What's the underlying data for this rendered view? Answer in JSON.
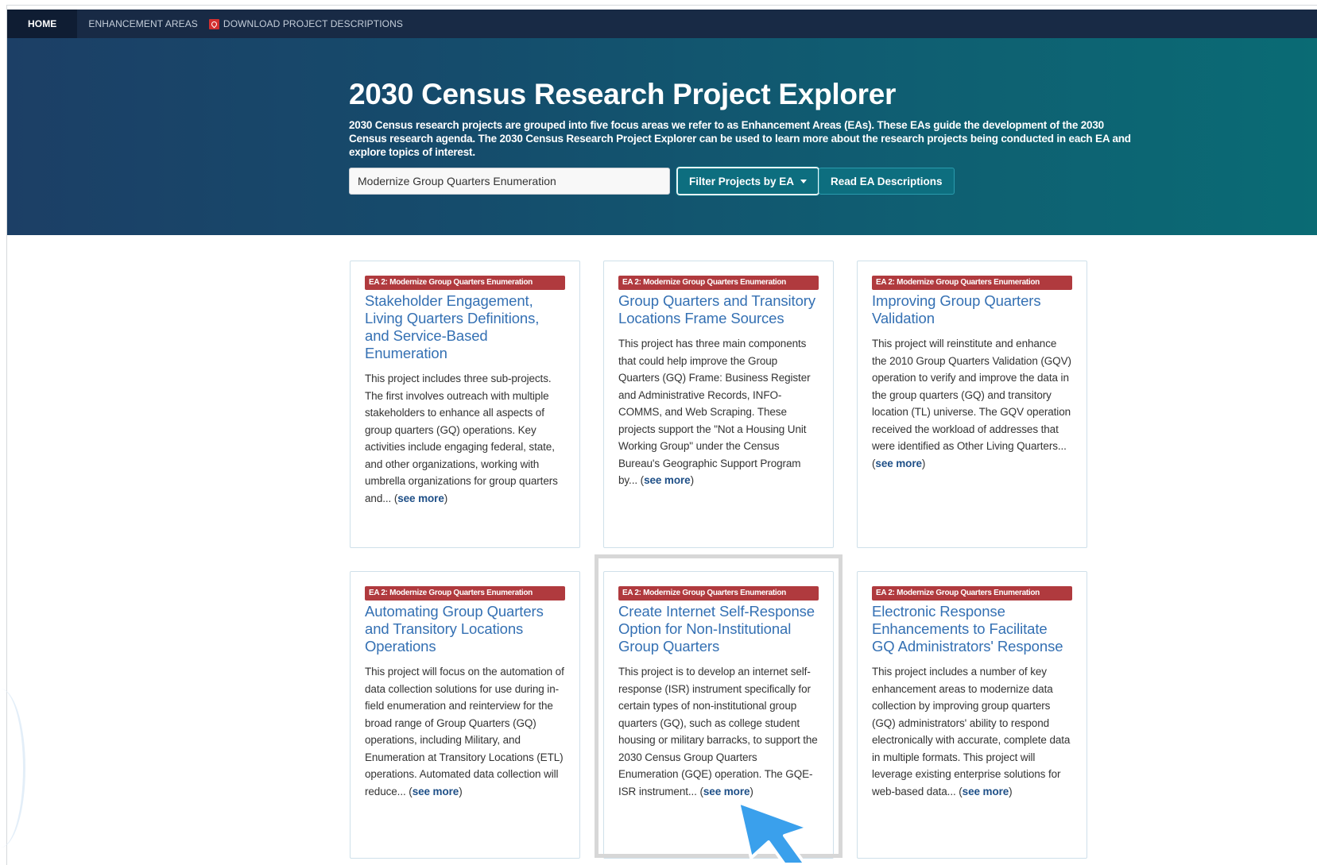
{
  "nav": {
    "home": "HOME",
    "enhancement_areas": "ENHANCEMENT AREAS",
    "download": "DOWNLOAD PROJECT DESCRIPTIONS",
    "download_icon": "pdf-icon"
  },
  "hero": {
    "title": "2030 Census Research Project Explorer",
    "description": "2030 Census research projects are grouped into five focus areas we refer to as Enhancement Areas (EAs). These EAs guide the development of the 2030 Census research agenda. The 2030 Census Research Project Explorer can be used to learn more about the research projects being conducted in each EA and explore topics of interest.",
    "search_value": "Modernize Group Quarters Enumeration",
    "filter_button": "Filter Projects by EA",
    "read_button": "Read EA Descriptions"
  },
  "cards": [
    {
      "badge": "EA 2: Modernize Group Quarters Enumeration",
      "title": "Stakeholder Engagement, Living Quarters Definitions, and Service-Based Enumeration",
      "body": "This project includes three sub-projects. The first involves outreach with multiple stakeholders to enhance all aspects of group quarters (GQ) operations. Key activities include engaging federal, state, and other organizations, working with umbrella organizations for group quarters and...",
      "see_more": "see more"
    },
    {
      "badge": "EA 2: Modernize Group Quarters Enumeration",
      "title": "Group Quarters and Transitory Locations Frame Sources",
      "body": "This project has three main components that could help improve the Group Quarters (GQ) Frame: Business Register and Administrative Records, INFO-COMMS, and Web Scraping. These projects support the \"Not a Housing Unit Working Group\" under the Census Bureau's Geographic Support Program by...",
      "see_more": "see more"
    },
    {
      "badge": "EA 2: Modernize Group Quarters Enumeration",
      "title": "Improving Group Quarters Validation",
      "body": "This project will reinstitute and enhance the 2010 Group Quarters Validation (GQV) operation to verify and improve the data in the group quarters (GQ) and transitory location (TL) universe. The GQV operation received the workload of addresses that were identified as Other Living Quarters...",
      "see_more": "see more"
    },
    {
      "badge": "EA 2: Modernize Group Quarters Enumeration",
      "title": "Automating Group Quarters and Transitory Locations Operations",
      "body": "This project will focus on the automation of data collection solutions for use during in-field enumeration and reinterview for the broad range of Group Quarters (GQ) operations, including Military, and Enumeration at Transitory Locations (ETL) operations. Automated data collection will reduce...",
      "see_more": "see more"
    },
    {
      "badge": "EA 2: Modernize Group Quarters Enumeration",
      "title": "Create Internet Self-Response Option for Non-Institutional Group Quarters",
      "body": "This project is to develop an internet self-response (ISR) instrument specifically for certain types of non-institutional group quarters (GQ), such as college student housing or military barracks, to support the 2030 Census Group Quarters Enumeration (GQE) operation. The GQE-ISR instrument...",
      "see_more": "see more"
    },
    {
      "badge": "EA 2: Modernize Group Quarters Enumeration",
      "title": "Electronic Response Enhancements to Facilitate GQ Administrators' Response",
      "body": "This project includes a number of key enhancement areas to modernize data collection by improving group quarters (GQ) administrators' ability to respond electronically with accurate, complete data in multiple formats. This project will leverage existing enterprise solutions for web-based data...",
      "see_more": "see more"
    }
  ],
  "colors": {
    "nav_bg": "#182a45",
    "hero_start": "#1c3f66",
    "hero_end": "#0a6b74",
    "button": "#0d6e7f",
    "badge": "#b03a3e",
    "title_link": "#3470b3",
    "cursor": "#3aa0ec"
  }
}
